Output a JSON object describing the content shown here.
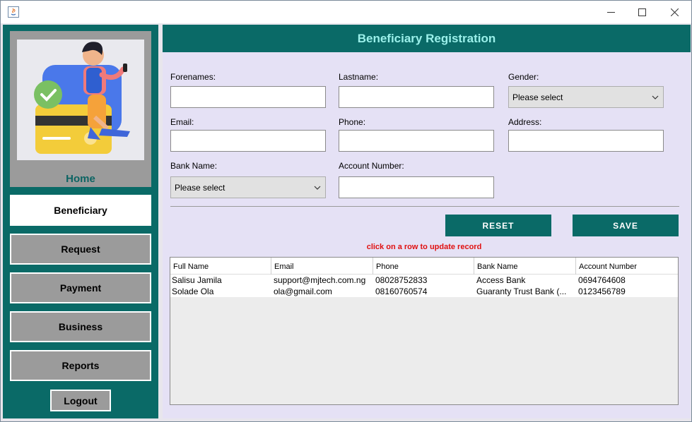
{
  "window": {
    "title": "",
    "controls": {
      "minimize": "minimize-icon",
      "maximize": "maximize-icon",
      "close": "close-icon"
    }
  },
  "sidebar": {
    "home_label": "Home",
    "items": [
      {
        "label": "Beneficiary",
        "active": true
      },
      {
        "label": "Request",
        "active": false
      },
      {
        "label": "Payment",
        "active": false
      },
      {
        "label": "Business",
        "active": false
      },
      {
        "label": "Reports",
        "active": false
      }
    ],
    "logout_label": "Logout"
  },
  "form": {
    "title": "Beneficiary Registration",
    "forenames": {
      "label": "Forenames:",
      "value": ""
    },
    "lastname": {
      "label": "Lastname:",
      "value": ""
    },
    "gender": {
      "label": "Gender:",
      "selected": "Please select"
    },
    "email": {
      "label": "Email:",
      "value": ""
    },
    "phone": {
      "label": "Phone:",
      "value": ""
    },
    "address": {
      "label": "Address:",
      "value": ""
    },
    "bank_name": {
      "label": "Bank Name:",
      "selected": "Please select"
    },
    "account_number": {
      "label": "Account Number:",
      "value": ""
    },
    "reset_label": "RESET",
    "save_label": "SAVE",
    "hint": "click on a row to update record"
  },
  "table": {
    "columns": [
      "Full Name",
      "Email",
      "Phone",
      "Bank Name",
      "Account Number"
    ],
    "rows": [
      [
        "Salisu Jamila",
        "support@mjtech.com.ng",
        "08028752833",
        "Access Bank",
        "0694764608"
      ],
      [
        "Solade Ola",
        "ola@gmail.com",
        "08160760574",
        "Guaranty Trust Bank (...",
        "0123456789"
      ]
    ]
  },
  "colors": {
    "teal": "#0a6a67",
    "header_text": "#9bf0ea",
    "panel": "#e5e1f5",
    "hint": "#e01010"
  }
}
